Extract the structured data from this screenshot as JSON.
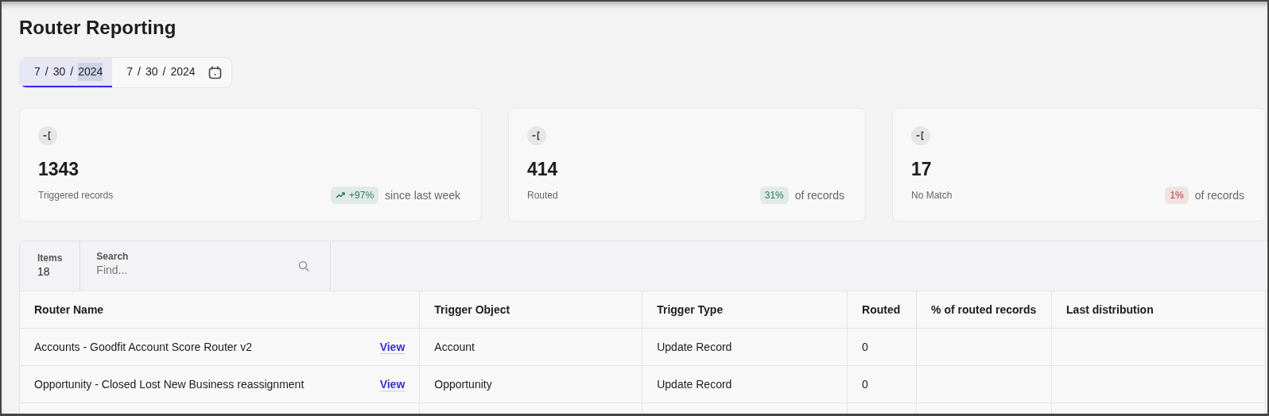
{
  "page_title": "Router Reporting",
  "date_range": [
    {
      "selected": true,
      "parts": [
        {
          "text": "7",
          "highlighted": false
        },
        {
          "text": "/",
          "highlighted": false
        },
        {
          "text": "30",
          "highlighted": false
        },
        {
          "text": "/",
          "highlighted": false
        },
        {
          "text": "2024",
          "highlighted": true
        }
      ]
    },
    {
      "selected": false,
      "parts": [
        {
          "text": "7",
          "highlighted": false
        },
        {
          "text": "/",
          "highlighted": false
        },
        {
          "text": "30",
          "highlighted": false
        },
        {
          "text": "/",
          "highlighted": false
        },
        {
          "text": "2024",
          "highlighted": false
        }
      ]
    }
  ],
  "stats": [
    {
      "value": "1343",
      "label": "Triggered records",
      "badge": "+97%",
      "color": "#2d7d58",
      "kind": "trend",
      "note": "since last week"
    },
    {
      "value": "414",
      "label": "Routed",
      "badge": "31%",
      "color": "#2d7d58",
      "kind": "plain",
      "note": "of records"
    },
    {
      "value": "17",
      "label": "No Match",
      "badge": "1%",
      "color": "#c0393b",
      "kind": "plain",
      "note": "of records"
    }
  ],
  "toolbar": {
    "items_label": "Items",
    "items_count": "18",
    "search_label": "Search",
    "search_placeholder": "Find..."
  },
  "table": {
    "columns": [
      "Router Name",
      "Trigger Object",
      "Trigger Type",
      "Routed",
      "% of routed records",
      "Last distribution"
    ],
    "rows": [
      {
        "name": "Accounts - Goodfit Account Score Router v2",
        "link": "View",
        "trigger_object": "Account",
        "trigger_type": "Update Record",
        "routed": "0"
      },
      {
        "name": "Opportunity - Closed Lost New Business reassignment",
        "link": "View",
        "trigger_object": "Opportunity",
        "trigger_type": "Update Record",
        "routed": "0"
      }
    ]
  }
}
